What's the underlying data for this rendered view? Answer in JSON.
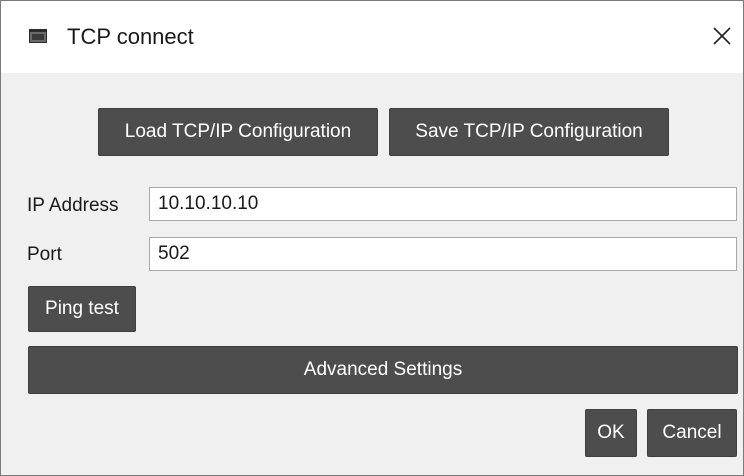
{
  "window": {
    "title": "TCP connect",
    "app_icon": "terminal-window-icon",
    "close_icon": "close-icon"
  },
  "config_buttons": {
    "load_label": "Load TCP/IP Configuration",
    "save_label": "Save TCP/IP Configuration"
  },
  "form": {
    "ip_label": "IP Address",
    "ip_value": "10.10.10.10",
    "port_label": "Port",
    "port_value": "502"
  },
  "actions": {
    "ping_label": "Ping test",
    "advanced_label": "Advanced Settings",
    "ok_label": "OK",
    "cancel_label": "Cancel"
  },
  "colors": {
    "button_bg": "#4d4d4d",
    "button_text": "#ffffff",
    "dialog_bg": "#f0f0f0"
  }
}
